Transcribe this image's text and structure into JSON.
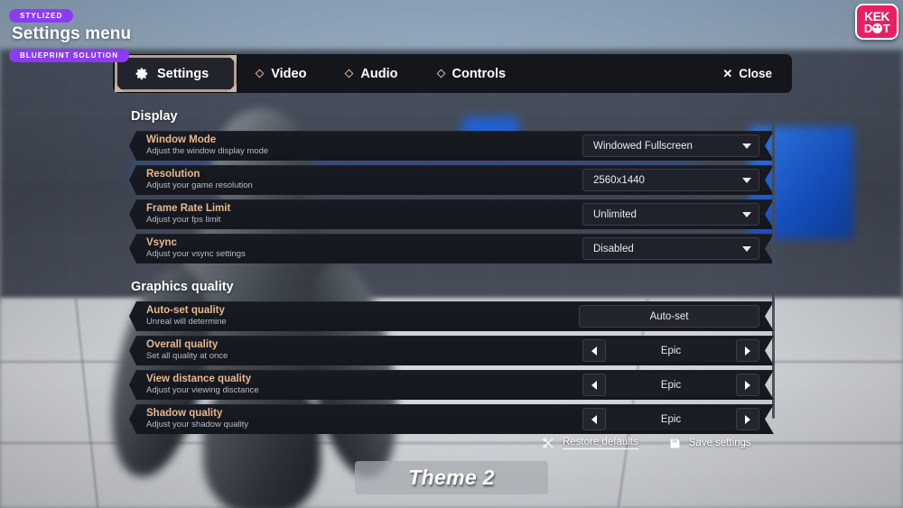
{
  "branding": {
    "pill_top": "STYLIZED",
    "title": "Settings menu",
    "pill_bottom": "BLUEPRINT SOLUTION",
    "logo_line1": "KEK",
    "logo_line2_pre": "D",
    "logo_line2_post": "T",
    "accent_purple": "#8a3df0",
    "logo_pink": "#ea1f63"
  },
  "tabs": [
    {
      "label": "Settings",
      "icon": "gear-icon",
      "active": true
    },
    {
      "label": "Video",
      "icon": "diamond-icon",
      "active": false
    },
    {
      "label": "Audio",
      "icon": "diamond-icon",
      "active": false
    },
    {
      "label": "Controls",
      "icon": "diamond-icon",
      "active": false
    }
  ],
  "close": {
    "label": "Close",
    "icon": "close-x-icon"
  },
  "sections": [
    {
      "title": "Display",
      "rows": [
        {
          "title": "Window Mode",
          "sub": "Adjust the window display mode",
          "control": "dropdown",
          "value": "Windowed Fullscreen"
        },
        {
          "title": "Resolution",
          "sub": "Adjust your game resolution",
          "control": "dropdown",
          "value": "2560x1440"
        },
        {
          "title": "Frame Rate Limit",
          "sub": "Adjust your fps limit",
          "control": "dropdown",
          "value": "Unlimited"
        },
        {
          "title": "Vsync",
          "sub": "Adjust your vsync settings",
          "control": "dropdown",
          "value": "Disabled"
        }
      ]
    },
    {
      "title": "Graphics quality",
      "rows": [
        {
          "title": "Auto-set quality",
          "sub": "Unreal will determine",
          "control": "button",
          "value": "Auto-set"
        },
        {
          "title": "Overall quality",
          "sub": "Set all quality at once",
          "control": "stepper",
          "value": "Epic"
        },
        {
          "title": "View distance quality",
          "sub": "Adjust your viewing disctance",
          "control": "stepper",
          "value": "Epic"
        },
        {
          "title": "Shadow quality",
          "sub": "Adjust your shadow quality",
          "control": "stepper",
          "value": "Epic"
        }
      ]
    }
  ],
  "footer": {
    "restore_label": "Restore defaults",
    "restore_icon": "scissors-icon",
    "save_label": "Save settings",
    "save_icon": "floppy-disk-icon"
  },
  "theme": {
    "label": "Theme 2"
  },
  "colors": {
    "row_label": "#e8b88d",
    "row_bg": "#181a22",
    "panel_bg": "#15161c",
    "tab_border": "#b3a093"
  }
}
